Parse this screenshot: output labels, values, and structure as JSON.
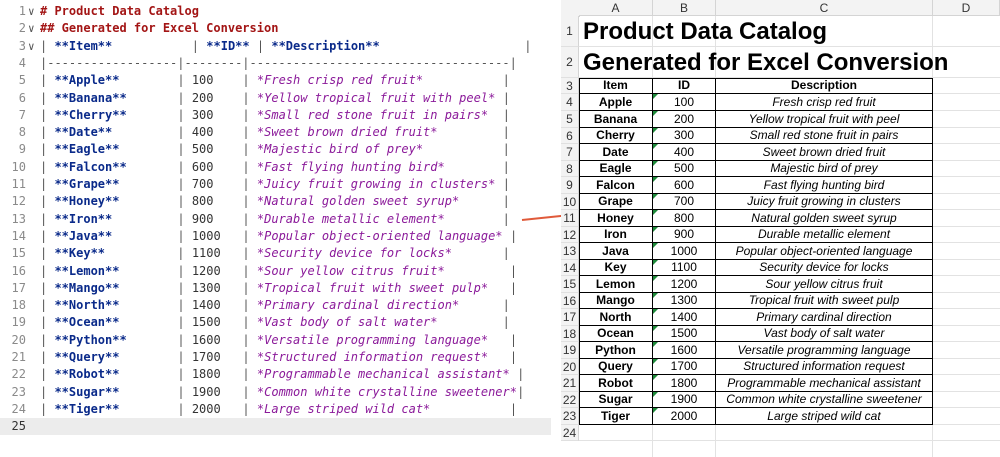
{
  "editor": {
    "lines": [
      {
        "n": "1",
        "fold": "∨",
        "tokens": [
          {
            "t": "# Product Data Catalog",
            "c": "md-h"
          }
        ]
      },
      {
        "n": "2",
        "fold": "∨",
        "tokens": [
          {
            "t": "## Generated for Excel Conversion",
            "c": "md-h"
          }
        ]
      },
      {
        "n": "3",
        "fold": "∨",
        "tokens": [
          {
            "t": "| ",
            "c": "md-pipe"
          },
          {
            "t": "**Item**",
            "c": "md-bold"
          },
          {
            "t": "           | ",
            "c": "md-pipe"
          },
          {
            "t": "**ID**",
            "c": "md-bold"
          },
          {
            "t": " | ",
            "c": "md-pipe"
          },
          {
            "t": "**Description**",
            "c": "md-bold"
          },
          {
            "t": "                    |",
            "c": "md-pipe"
          }
        ]
      },
      {
        "n": "4",
        "fold": "",
        "tokens": [
          {
            "t": "|------------------|--------|------------------------------------|",
            "c": "md-dash"
          }
        ]
      },
      {
        "n": "5",
        "fold": "",
        "tokens": [
          {
            "t": "| ",
            "c": "md-pipe"
          },
          {
            "t": "**Apple**",
            "c": "md-bold"
          },
          {
            "t": "        | ",
            "c": "md-pipe"
          },
          {
            "t": "100",
            "c": "md-num"
          },
          {
            "t": "    | ",
            "c": "md-pipe"
          },
          {
            "t": "*Fresh crisp red fruit*",
            "c": "md-italic"
          },
          {
            "t": "           |",
            "c": "md-pipe"
          }
        ]
      },
      {
        "n": "6",
        "fold": "",
        "tokens": [
          {
            "t": "| ",
            "c": "md-pipe"
          },
          {
            "t": "**Banana**",
            "c": "md-bold"
          },
          {
            "t": "       | ",
            "c": "md-pipe"
          },
          {
            "t": "200",
            "c": "md-num"
          },
          {
            "t": "    | ",
            "c": "md-pipe"
          },
          {
            "t": "*Yellow tropical fruit with peel*",
            "c": "md-italic"
          },
          {
            "t": " |",
            "c": "md-pipe"
          }
        ]
      },
      {
        "n": "7",
        "fold": "",
        "tokens": [
          {
            "t": "| ",
            "c": "md-pipe"
          },
          {
            "t": "**Cherry**",
            "c": "md-bold"
          },
          {
            "t": "       | ",
            "c": "md-pipe"
          },
          {
            "t": "300",
            "c": "md-num"
          },
          {
            "t": "    | ",
            "c": "md-pipe"
          },
          {
            "t": "*Small red stone fruit in pairs*",
            "c": "md-italic"
          },
          {
            "t": "  |",
            "c": "md-pipe"
          }
        ]
      },
      {
        "n": "8",
        "fold": "",
        "tokens": [
          {
            "t": "| ",
            "c": "md-pipe"
          },
          {
            "t": "**Date**",
            "c": "md-bold"
          },
          {
            "t": "         | ",
            "c": "md-pipe"
          },
          {
            "t": "400",
            "c": "md-num"
          },
          {
            "t": "    | ",
            "c": "md-pipe"
          },
          {
            "t": "*Sweet brown dried fruit*",
            "c": "md-italic"
          },
          {
            "t": "         |",
            "c": "md-pipe"
          }
        ]
      },
      {
        "n": "9",
        "fold": "",
        "tokens": [
          {
            "t": "| ",
            "c": "md-pipe"
          },
          {
            "t": "**Eagle**",
            "c": "md-bold"
          },
          {
            "t": "        | ",
            "c": "md-pipe"
          },
          {
            "t": "500",
            "c": "md-num"
          },
          {
            "t": "    | ",
            "c": "md-pipe"
          },
          {
            "t": "*Majestic bird of prey*",
            "c": "md-italic"
          },
          {
            "t": "           |",
            "c": "md-pipe"
          }
        ]
      },
      {
        "n": "10",
        "fold": "",
        "tokens": [
          {
            "t": "| ",
            "c": "md-pipe"
          },
          {
            "t": "**Falcon**",
            "c": "md-bold"
          },
          {
            "t": "       | ",
            "c": "md-pipe"
          },
          {
            "t": "600",
            "c": "md-num"
          },
          {
            "t": "    | ",
            "c": "md-pipe"
          },
          {
            "t": "*Fast flying hunting bird*",
            "c": "md-italic"
          },
          {
            "t": "        |",
            "c": "md-pipe"
          }
        ]
      },
      {
        "n": "11",
        "fold": "",
        "tokens": [
          {
            "t": "| ",
            "c": "md-pipe"
          },
          {
            "t": "**Grape**",
            "c": "md-bold"
          },
          {
            "t": "        | ",
            "c": "md-pipe"
          },
          {
            "t": "700",
            "c": "md-num"
          },
          {
            "t": "    | ",
            "c": "md-pipe"
          },
          {
            "t": "*Juicy fruit growing in clusters*",
            "c": "md-italic"
          },
          {
            "t": " |",
            "c": "md-pipe"
          }
        ]
      },
      {
        "n": "12",
        "fold": "",
        "tokens": [
          {
            "t": "| ",
            "c": "md-pipe"
          },
          {
            "t": "**Honey**",
            "c": "md-bold"
          },
          {
            "t": "        | ",
            "c": "md-pipe"
          },
          {
            "t": "800",
            "c": "md-num"
          },
          {
            "t": "    | ",
            "c": "md-pipe"
          },
          {
            "t": "*Natural golden sweet syrup*",
            "c": "md-italic"
          },
          {
            "t": "      |",
            "c": "md-pipe"
          }
        ]
      },
      {
        "n": "13",
        "fold": "",
        "tokens": [
          {
            "t": "| ",
            "c": "md-pipe"
          },
          {
            "t": "**Iron**",
            "c": "md-bold"
          },
          {
            "t": "         | ",
            "c": "md-pipe"
          },
          {
            "t": "900",
            "c": "md-num"
          },
          {
            "t": "    | ",
            "c": "md-pipe"
          },
          {
            "t": "*Durable metallic element*",
            "c": "md-italic"
          },
          {
            "t": "        |",
            "c": "md-pipe"
          }
        ]
      },
      {
        "n": "14",
        "fold": "",
        "tokens": [
          {
            "t": "| ",
            "c": "md-pipe"
          },
          {
            "t": "**Java**",
            "c": "md-bold"
          },
          {
            "t": "         | ",
            "c": "md-pipe"
          },
          {
            "t": "1000",
            "c": "md-num"
          },
          {
            "t": "   | ",
            "c": "md-pipe"
          },
          {
            "t": "*Popular object-oriented language*",
            "c": "md-italic"
          },
          {
            "t": " |",
            "c": "md-pipe"
          }
        ]
      },
      {
        "n": "15",
        "fold": "",
        "tokens": [
          {
            "t": "| ",
            "c": "md-pipe"
          },
          {
            "t": "**Key**",
            "c": "md-bold"
          },
          {
            "t": "          | ",
            "c": "md-pipe"
          },
          {
            "t": "1100",
            "c": "md-num"
          },
          {
            "t": "   | ",
            "c": "md-pipe"
          },
          {
            "t": "*Security device for locks*",
            "c": "md-italic"
          },
          {
            "t": "       |",
            "c": "md-pipe"
          }
        ]
      },
      {
        "n": "16",
        "fold": "",
        "tokens": [
          {
            "t": "| ",
            "c": "md-pipe"
          },
          {
            "t": "**Lemon**",
            "c": "md-bold"
          },
          {
            "t": "        | ",
            "c": "md-pipe"
          },
          {
            "t": "1200",
            "c": "md-num"
          },
          {
            "t": "   | ",
            "c": "md-pipe"
          },
          {
            "t": "*Sour yellow citrus fruit*",
            "c": "md-italic"
          },
          {
            "t": "         |",
            "c": "md-pipe"
          }
        ]
      },
      {
        "n": "17",
        "fold": "",
        "tokens": [
          {
            "t": "| ",
            "c": "md-pipe"
          },
          {
            "t": "**Mango**",
            "c": "md-bold"
          },
          {
            "t": "        | ",
            "c": "md-pipe"
          },
          {
            "t": "1300",
            "c": "md-num"
          },
          {
            "t": "   | ",
            "c": "md-pipe"
          },
          {
            "t": "*Tropical fruit with sweet pulp*",
            "c": "md-italic"
          },
          {
            "t": "   |",
            "c": "md-pipe"
          }
        ]
      },
      {
        "n": "18",
        "fold": "",
        "tokens": [
          {
            "t": "| ",
            "c": "md-pipe"
          },
          {
            "t": "**North**",
            "c": "md-bold"
          },
          {
            "t": "        | ",
            "c": "md-pipe"
          },
          {
            "t": "1400",
            "c": "md-num"
          },
          {
            "t": "   | ",
            "c": "md-pipe"
          },
          {
            "t": "*Primary cardinal direction*",
            "c": "md-italic"
          },
          {
            "t": "      |",
            "c": "md-pipe"
          }
        ]
      },
      {
        "n": "19",
        "fold": "",
        "tokens": [
          {
            "t": "| ",
            "c": "md-pipe"
          },
          {
            "t": "**Ocean**",
            "c": "md-bold"
          },
          {
            "t": "        | ",
            "c": "md-pipe"
          },
          {
            "t": "1500",
            "c": "md-num"
          },
          {
            "t": "   | ",
            "c": "md-pipe"
          },
          {
            "t": "*Vast body of salt water*",
            "c": "md-italic"
          },
          {
            "t": "         |",
            "c": "md-pipe"
          }
        ]
      },
      {
        "n": "20",
        "fold": "",
        "tokens": [
          {
            "t": "| ",
            "c": "md-pipe"
          },
          {
            "t": "**Python**",
            "c": "md-bold"
          },
          {
            "t": "       | ",
            "c": "md-pipe"
          },
          {
            "t": "1600",
            "c": "md-num"
          },
          {
            "t": "   | ",
            "c": "md-pipe"
          },
          {
            "t": "*Versatile programming language*",
            "c": "md-italic"
          },
          {
            "t": "   |",
            "c": "md-pipe"
          }
        ]
      },
      {
        "n": "21",
        "fold": "",
        "tokens": [
          {
            "t": "| ",
            "c": "md-pipe"
          },
          {
            "t": "**Query**",
            "c": "md-bold"
          },
          {
            "t": "        | ",
            "c": "md-pipe"
          },
          {
            "t": "1700",
            "c": "md-num"
          },
          {
            "t": "   | ",
            "c": "md-pipe"
          },
          {
            "t": "*Structured information request*",
            "c": "md-italic"
          },
          {
            "t": "   |",
            "c": "md-pipe"
          }
        ]
      },
      {
        "n": "22",
        "fold": "",
        "tokens": [
          {
            "t": "| ",
            "c": "md-pipe"
          },
          {
            "t": "**Robot**",
            "c": "md-bold"
          },
          {
            "t": "        | ",
            "c": "md-pipe"
          },
          {
            "t": "1800",
            "c": "md-num"
          },
          {
            "t": "   | ",
            "c": "md-pipe"
          },
          {
            "t": "*Programmable mechanical assistant*",
            "c": "md-italic"
          },
          {
            "t": " |",
            "c": "md-pipe"
          }
        ]
      },
      {
        "n": "23",
        "fold": "",
        "tokens": [
          {
            "t": "| ",
            "c": "md-pipe"
          },
          {
            "t": "**Sugar**",
            "c": "md-bold"
          },
          {
            "t": "        | ",
            "c": "md-pipe"
          },
          {
            "t": "1900",
            "c": "md-num"
          },
          {
            "t": "   | ",
            "c": "md-pipe"
          },
          {
            "t": "*Common white crystalline sweetener*",
            "c": "md-italic"
          },
          {
            "t": "|",
            "c": "md-pipe"
          }
        ]
      },
      {
        "n": "24",
        "fold": "",
        "tokens": [
          {
            "t": "| ",
            "c": "md-pipe"
          },
          {
            "t": "**Tiger**",
            "c": "md-bold"
          },
          {
            "t": "        | ",
            "c": "md-pipe"
          },
          {
            "t": "2000",
            "c": "md-num"
          },
          {
            "t": "   | ",
            "c": "md-pipe"
          },
          {
            "t": "*Large striped wild cat*",
            "c": "md-italic"
          },
          {
            "t": "           |",
            "c": "md-pipe"
          }
        ]
      },
      {
        "n": "25",
        "fold": "",
        "tokens": [],
        "active": true
      }
    ]
  },
  "sheet": {
    "columns": [
      "A",
      "B",
      "C",
      "D"
    ],
    "title": "Product Data Catalog",
    "subtitle": "Generated for Excel Conversion",
    "headers": [
      "Item",
      "ID",
      "Description"
    ],
    "rows": [
      [
        "Apple",
        "100",
        "Fresh crisp red fruit"
      ],
      [
        "Banana",
        "200",
        "Yellow tropical fruit with peel"
      ],
      [
        "Cherry",
        "300",
        "Small red stone fruit in pairs"
      ],
      [
        "Date",
        "400",
        "Sweet brown dried fruit"
      ],
      [
        "Eagle",
        "500",
        "Majestic bird of prey"
      ],
      [
        "Falcon",
        "600",
        "Fast flying hunting bird"
      ],
      [
        "Grape",
        "700",
        "Juicy fruit growing in clusters"
      ],
      [
        "Honey",
        "800",
        "Natural golden sweet syrup"
      ],
      [
        "Iron",
        "900",
        "Durable metallic element"
      ],
      [
        "Java",
        "1000",
        "Popular object-oriented language"
      ],
      [
        "Key",
        "1100",
        "Security device for locks"
      ],
      [
        "Lemon",
        "1200",
        "Sour yellow citrus fruit"
      ],
      [
        "Mango",
        "1300",
        "Tropical fruit with sweet pulp"
      ],
      [
        "North",
        "1400",
        "Primary cardinal direction"
      ],
      [
        "Ocean",
        "1500",
        "Vast body of salt water"
      ],
      [
        "Python",
        "1600",
        "Versatile programming language"
      ],
      [
        "Query",
        "1700",
        "Structured information request"
      ],
      [
        "Robot",
        "1800",
        "Programmable mechanical assistant"
      ],
      [
        "Sugar",
        "1900",
        "Common white crystalline sweetener"
      ],
      [
        "Tiger",
        "2000",
        "Large striped wild cat"
      ]
    ],
    "row_numbers": [
      "1",
      "2",
      "3",
      "4",
      "5",
      "6",
      "7",
      "8",
      "9",
      "10",
      "11",
      "12",
      "13",
      "14",
      "15",
      "16",
      "17",
      "18",
      "19",
      "20",
      "21",
      "22",
      "23",
      "24"
    ]
  },
  "colors": {
    "arrow": "#e05a3a",
    "number_text_indicator": "#1e8a3a"
  },
  "icons": {
    "fold": "chevron-down-icon",
    "cell_flag": "number-stored-as-text-icon",
    "arrow": "conversion-arrow-icon"
  }
}
